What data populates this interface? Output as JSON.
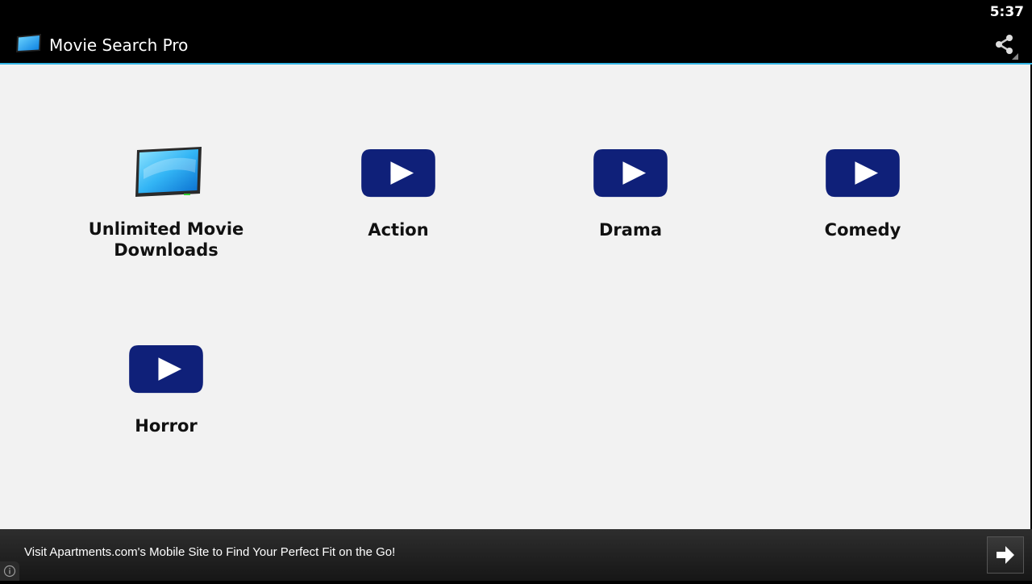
{
  "status_bar": {
    "time": "5:37"
  },
  "action_bar": {
    "app_icon": "tablet-screen-icon",
    "title": "Movie Search Pro",
    "share_icon": "share-icon"
  },
  "grid": {
    "items": [
      {
        "label_line1": "Unlimited Movie",
        "label_line2": "Downloads",
        "icon": "tablet-screen-icon"
      },
      {
        "label": "Action",
        "icon": "play-button-icon"
      },
      {
        "label": "Drama",
        "icon": "play-button-icon"
      },
      {
        "label": "Comedy",
        "icon": "play-button-icon"
      },
      {
        "label": "Horror",
        "icon": "play-button-icon"
      }
    ]
  },
  "ad_bar": {
    "text": "Visit Apartments.com's Mobile Site to Find Your Perfect Fit on the Go!",
    "arrow_icon": "arrow-right-icon",
    "info_icon": "info-icon"
  },
  "colors": {
    "accent": "#33b5e5",
    "play_button": "#0f2079",
    "background": "#f2f2f2"
  }
}
